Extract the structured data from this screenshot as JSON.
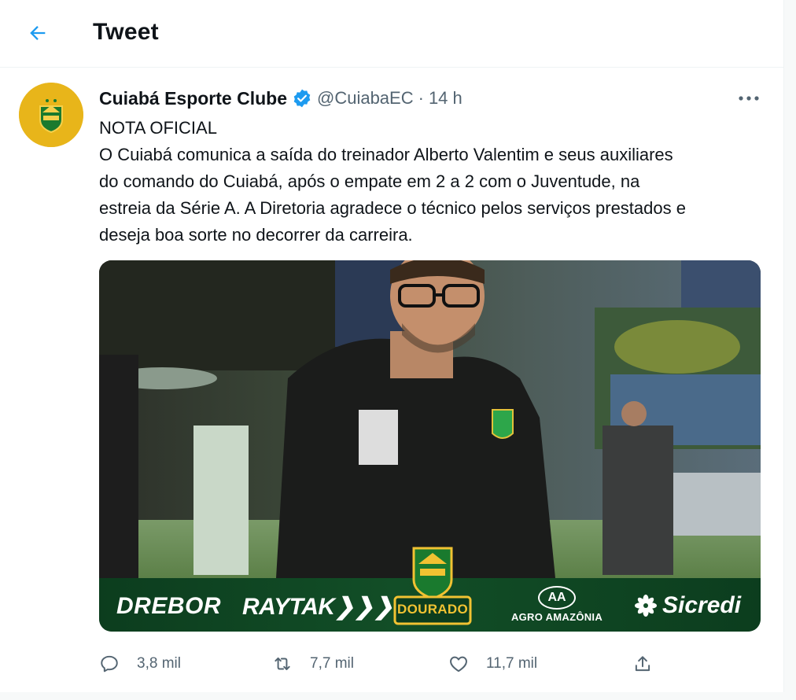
{
  "header": {
    "title": "Tweet",
    "back_icon": "arrow-left-icon"
  },
  "tweet": {
    "author": {
      "display_name": "Cuiabá Esporte Clube",
      "verified": true,
      "handle": "@CuiabaEC",
      "separator": "·",
      "time": "14 h"
    },
    "more_icon": "more-horizontal-icon",
    "text_lines": [
      "NOTA OFICIAL",
      "O Cuiabá comunica a saída do treinador Alberto Valentim e seus auxiliares",
      "do comando do Cuiabá, após o empate em 2 a 2 com o Juventude, na",
      "estreia da Série A. A Diretoria agradece o técnico pelos serviços prestados e",
      "deseja boa sorte no decorrer da carreira."
    ],
    "media": {
      "sponsors": {
        "drebor": "DREBOR",
        "raytak": "RAYTAK",
        "dourado": "DOURADO",
        "agro_mark": "AA",
        "agro": "AGRO AMAZÔNIA",
        "sicredi": "Sicredi"
      }
    },
    "actions": {
      "reply_count": "3,8 mil",
      "retweet_count": "7,7 mil",
      "like_count": "11,7 mil"
    }
  },
  "colors": {
    "accent": "#1d9bf0",
    "text_primary": "#0f1419",
    "text_secondary": "#536471",
    "club_gold": "#e8b51a",
    "club_green": "#1a7a2e"
  }
}
